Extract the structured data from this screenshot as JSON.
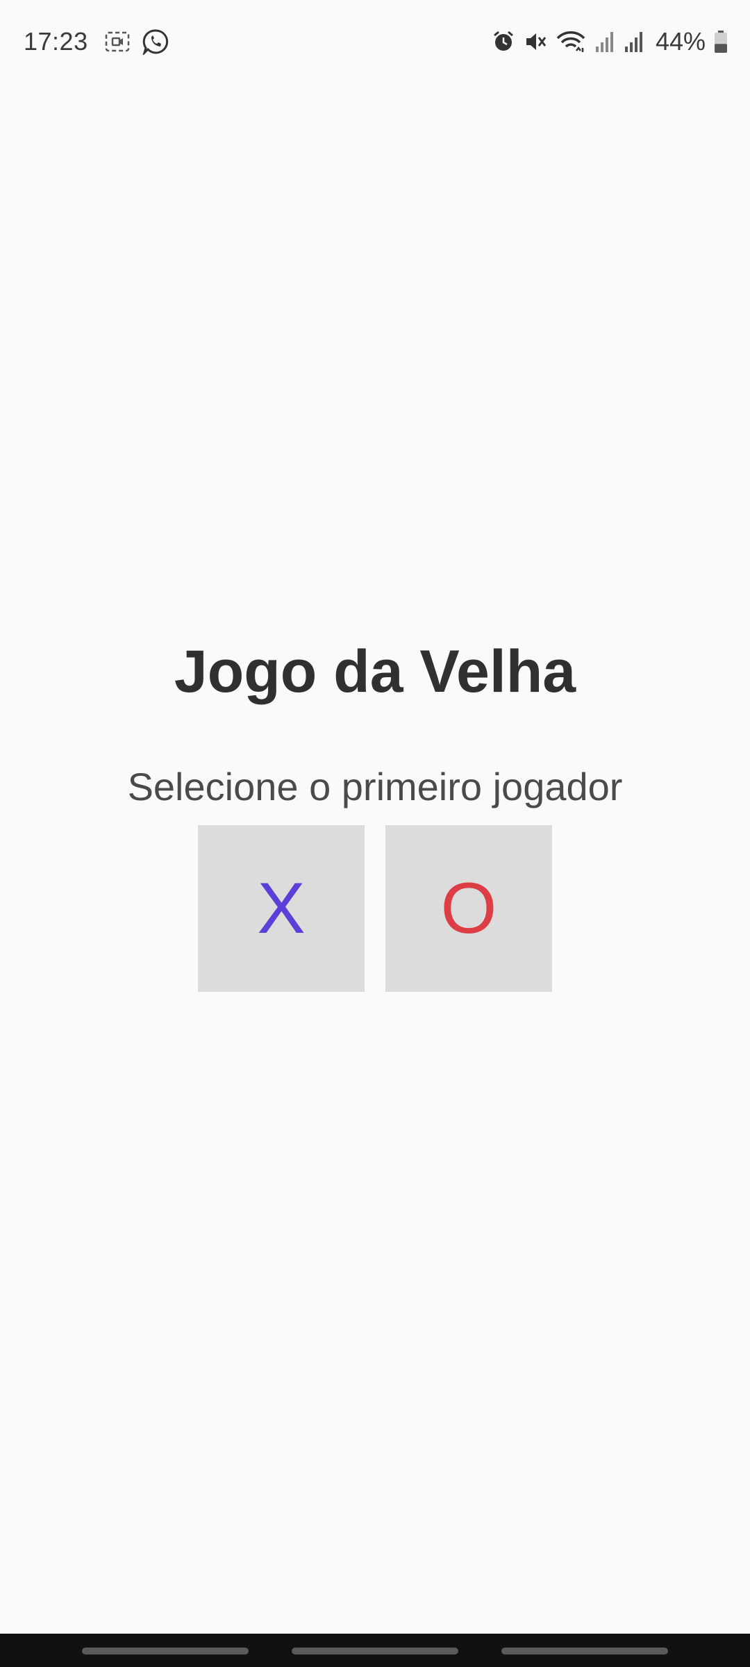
{
  "status_bar": {
    "time": "17:23",
    "battery_percent": "44%",
    "battery_level": 0.44,
    "icons_left": [
      "screen-record-icon",
      "whatsapp-icon"
    ],
    "icons_right": [
      "alarm-icon",
      "mute-icon",
      "wifi-icon",
      "signal-icon",
      "signal-icon",
      "battery-icon"
    ]
  },
  "game": {
    "title": "Jogo da Velha",
    "subtitle": "Selecione o primeiro jogador",
    "choices": [
      {
        "label": "X",
        "color": "#5b3fd8"
      },
      {
        "label": "O",
        "color": "#dd3d45"
      }
    ]
  },
  "colors": {
    "background": "#fafafa",
    "button_bg": "#dcdcdc",
    "nav_bar": "#111111"
  }
}
